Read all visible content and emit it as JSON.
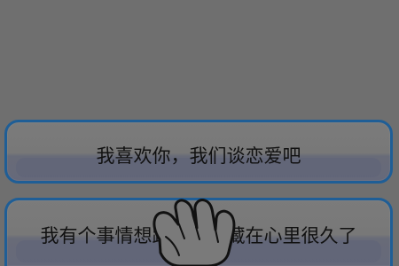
{
  "dialogue": {
    "choices": [
      {
        "label": "我喜欢你，我们谈恋爱吧"
      },
      {
        "label": "我有个事情想跟你说，藏在心里很久了"
      }
    ]
  },
  "colors": {
    "overlay": "#6f6f6f",
    "choice_border": "#1f5e96",
    "text": "#111111"
  },
  "icons": {
    "pointer": "tap-hand-icon"
  }
}
